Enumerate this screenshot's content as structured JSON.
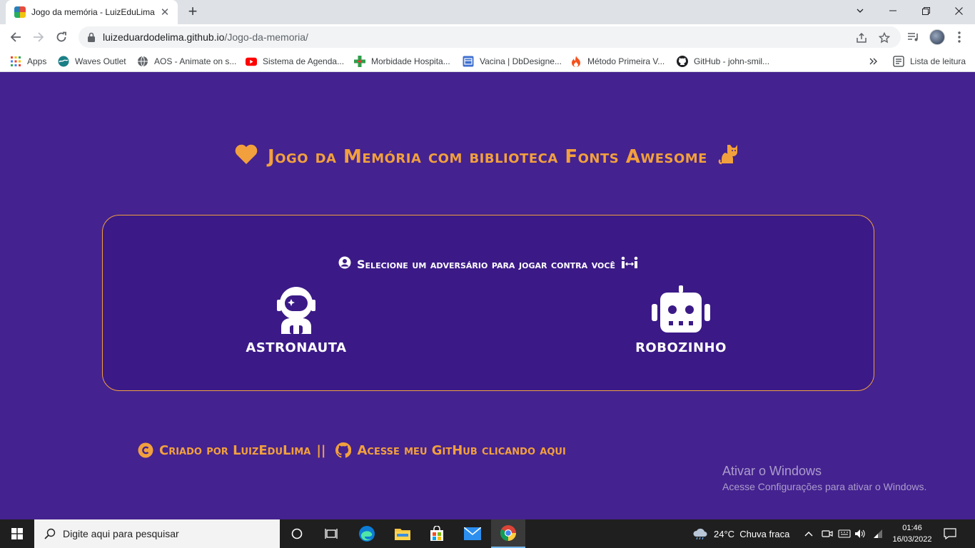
{
  "browser": {
    "tab": {
      "title": "Jogo da memória - LuizEduLima",
      "close": "✕"
    },
    "new_tab": "+",
    "url": {
      "host": "luizeduardodelima.github.io",
      "path": "/Jogo-da-memoria/"
    }
  },
  "bookmarks": [
    {
      "label": "Apps",
      "icon": "apps-grid-icon"
    },
    {
      "label": "Waves Outlet",
      "icon": "waves-icon"
    },
    {
      "label": "AOS - Animate on s...",
      "icon": "globe-icon"
    },
    {
      "label": "Sistema de Agenda...",
      "icon": "youtube-icon"
    },
    {
      "label": "Morbidade Hospita...",
      "icon": "health-cross-icon"
    },
    {
      "label": "Vacina | DbDesigne...",
      "icon": "dbdesigner-icon"
    },
    {
      "label": "Método Primeira V...",
      "icon": "flame-icon"
    },
    {
      "label": "GitHub - john-smil...",
      "icon": "github-icon"
    }
  ],
  "reading_list": "Lista de leitura",
  "page": {
    "title": "Jogo da Memória com biblioteca Fonts Awesome",
    "subtitle": "Selecione um adversário para jogar contra você",
    "opponents": [
      {
        "label": "ASTRONAUTA",
        "icon": "astronaut-icon"
      },
      {
        "label": "ROBOZINHO",
        "icon": "robot-icon"
      }
    ],
    "footer": {
      "created_by": "Criado por LuizEduLima",
      "separator": "||",
      "github_link": "Acesse meu GitHub clicando aqui"
    },
    "colors": {
      "background": "#44228f",
      "accent": "#f2a03d",
      "panel": "#3b1a87"
    }
  },
  "watermark": {
    "title": "Ativar o Windows",
    "subtitle": "Acesse Configurações para ativar o Windows."
  },
  "taskbar": {
    "search_placeholder": "Digite aqui para pesquisar",
    "weather": "24°C  Chuva fraca",
    "time": "01:46",
    "date": "16/03/2022"
  }
}
